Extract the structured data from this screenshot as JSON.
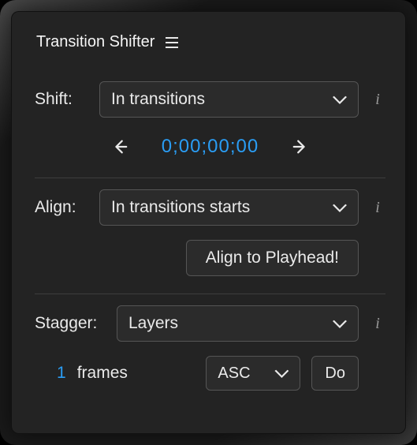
{
  "panel": {
    "title": "Transition Shifter"
  },
  "shift": {
    "label": "Shift:",
    "select_value": "In transitions",
    "timecode": "0;00;00;00"
  },
  "align": {
    "label": "Align:",
    "select_value": "In transitions starts",
    "button": "Align to Playhead!"
  },
  "stagger": {
    "label": "Stagger:",
    "select_value": "Layers",
    "count": "1",
    "unit": "frames",
    "order": "ASC",
    "go": "Do"
  }
}
